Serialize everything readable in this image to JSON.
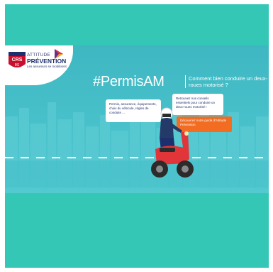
{
  "logo": {
    "crs_badge": "CRS MJ",
    "attitude": "ATTITUDE",
    "prevention": "PRÉVENTION",
    "tagline": "Les assureurs se mobilisent",
    "play_icon": "play-triangle"
  },
  "headline": {
    "hashtag": "#PermisAM",
    "subtitle": "Comment bien conduire un deux-roues motorisé ?"
  },
  "bubbles": {
    "left": "Permis, assurance, équipements, choix du véhicule, règles de conduite ...",
    "right": "Retrouvez nos conseils essentiels pour conduire un deux-roues motorisé !"
  },
  "cta": {
    "label": "Découvrez notre guide d'Attitude Prévention"
  },
  "colors": {
    "outer_teal": "#34c7b6",
    "banner_teal": "#49c2cc",
    "cta_orange": "#f26c22",
    "scooter_red": "#e2353a",
    "navy": "#1e2f6e"
  }
}
